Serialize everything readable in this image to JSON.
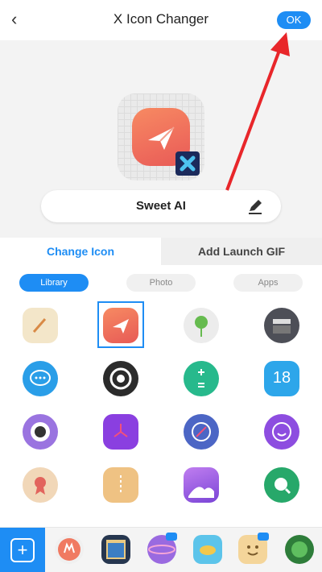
{
  "header": {
    "title": "X Icon Changer",
    "ok_label": "OK"
  },
  "preview": {
    "remove_label": "remove",
    "app_name": "Sweet AI"
  },
  "tabs": [
    {
      "label": "Change Icon"
    },
    {
      "label": "Add Launch GIF"
    }
  ],
  "segments": [
    {
      "label": "Library"
    },
    {
      "label": "Photo"
    },
    {
      "label": "Apps"
    }
  ],
  "grid_icons": [
    "notes-icon",
    "paper-plane-icon",
    "bulb-icon",
    "clapper-icon",
    "chat-icon",
    "camera-aperture-icon",
    "calculator-icon",
    "calendar-18-icon",
    "camera-lens-icon",
    "clock-icon",
    "compass-icon",
    "refresh-ring-icon",
    "award-icon",
    "file-zip-icon",
    "gallery-icon",
    "search-icon"
  ],
  "calendar_day": "18",
  "bottom_apps": [
    "music-app-icon",
    "calendar-app-icon",
    "planet-app-icon",
    "fish-app-icon",
    "smiley-app-icon",
    "green-circle-app-icon"
  ]
}
